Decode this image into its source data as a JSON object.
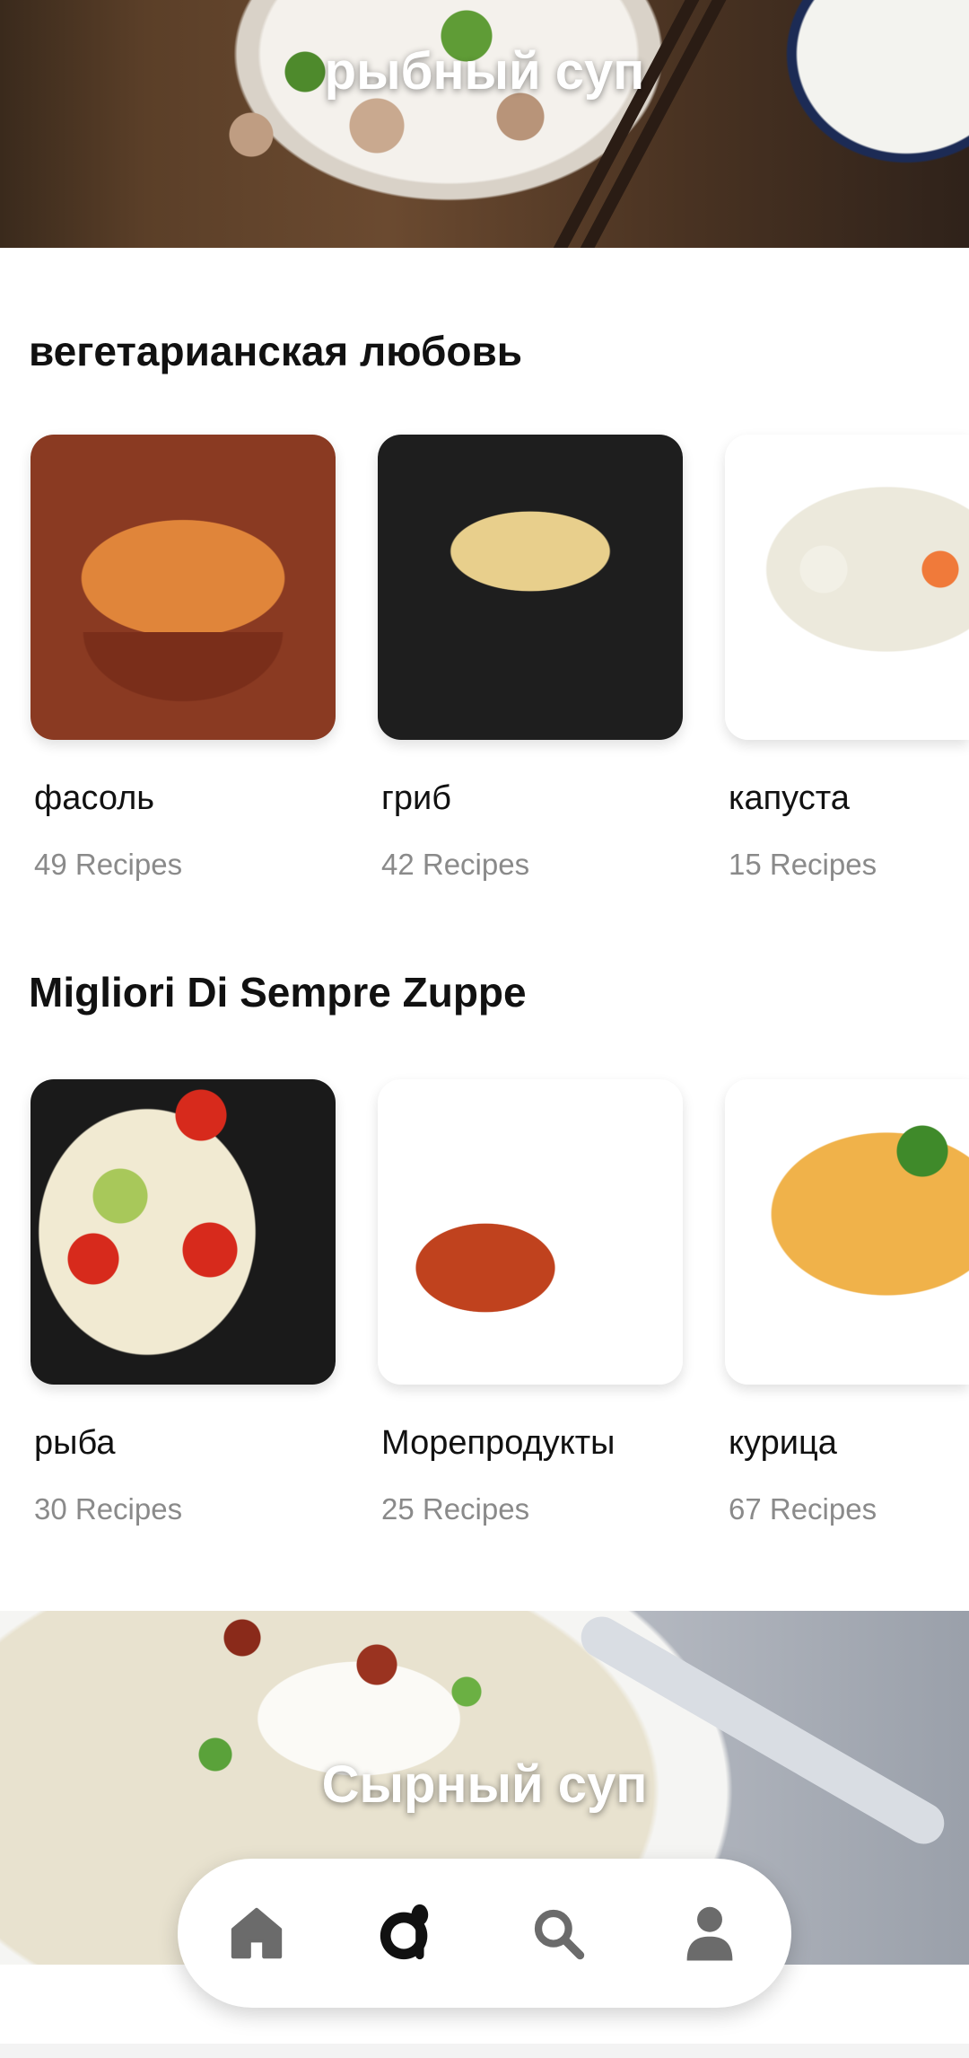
{
  "banner_top": {
    "title": "рыбный суп"
  },
  "sections": [
    {
      "title": "вегетарианская любовь",
      "items": [
        {
          "name": "фасоль",
          "count": "49 Recipes"
        },
        {
          "name": "гриб",
          "count": "42 Recipes"
        },
        {
          "name": "капуста",
          "count": "15 Recipes"
        }
      ]
    },
    {
      "title": "Migliori Di Sempre Zuppe",
      "items": [
        {
          "name": "рыба",
          "count": "30 Recipes"
        },
        {
          "name": "Морепродукты",
          "count": "25 Recipes"
        },
        {
          "name": "курица",
          "count": "67 Recipes"
        }
      ]
    }
  ],
  "banner_bottom": {
    "title": "Сырный суп"
  },
  "bottom_nav": {
    "items": [
      {
        "icon": "home-icon",
        "active": false
      },
      {
        "icon": "recipes-icon",
        "active": true
      },
      {
        "icon": "search-icon",
        "active": false
      },
      {
        "icon": "profile-icon",
        "active": false
      }
    ],
    "colors": {
      "active": "#111111",
      "inactive": "#6b6b6b"
    }
  }
}
